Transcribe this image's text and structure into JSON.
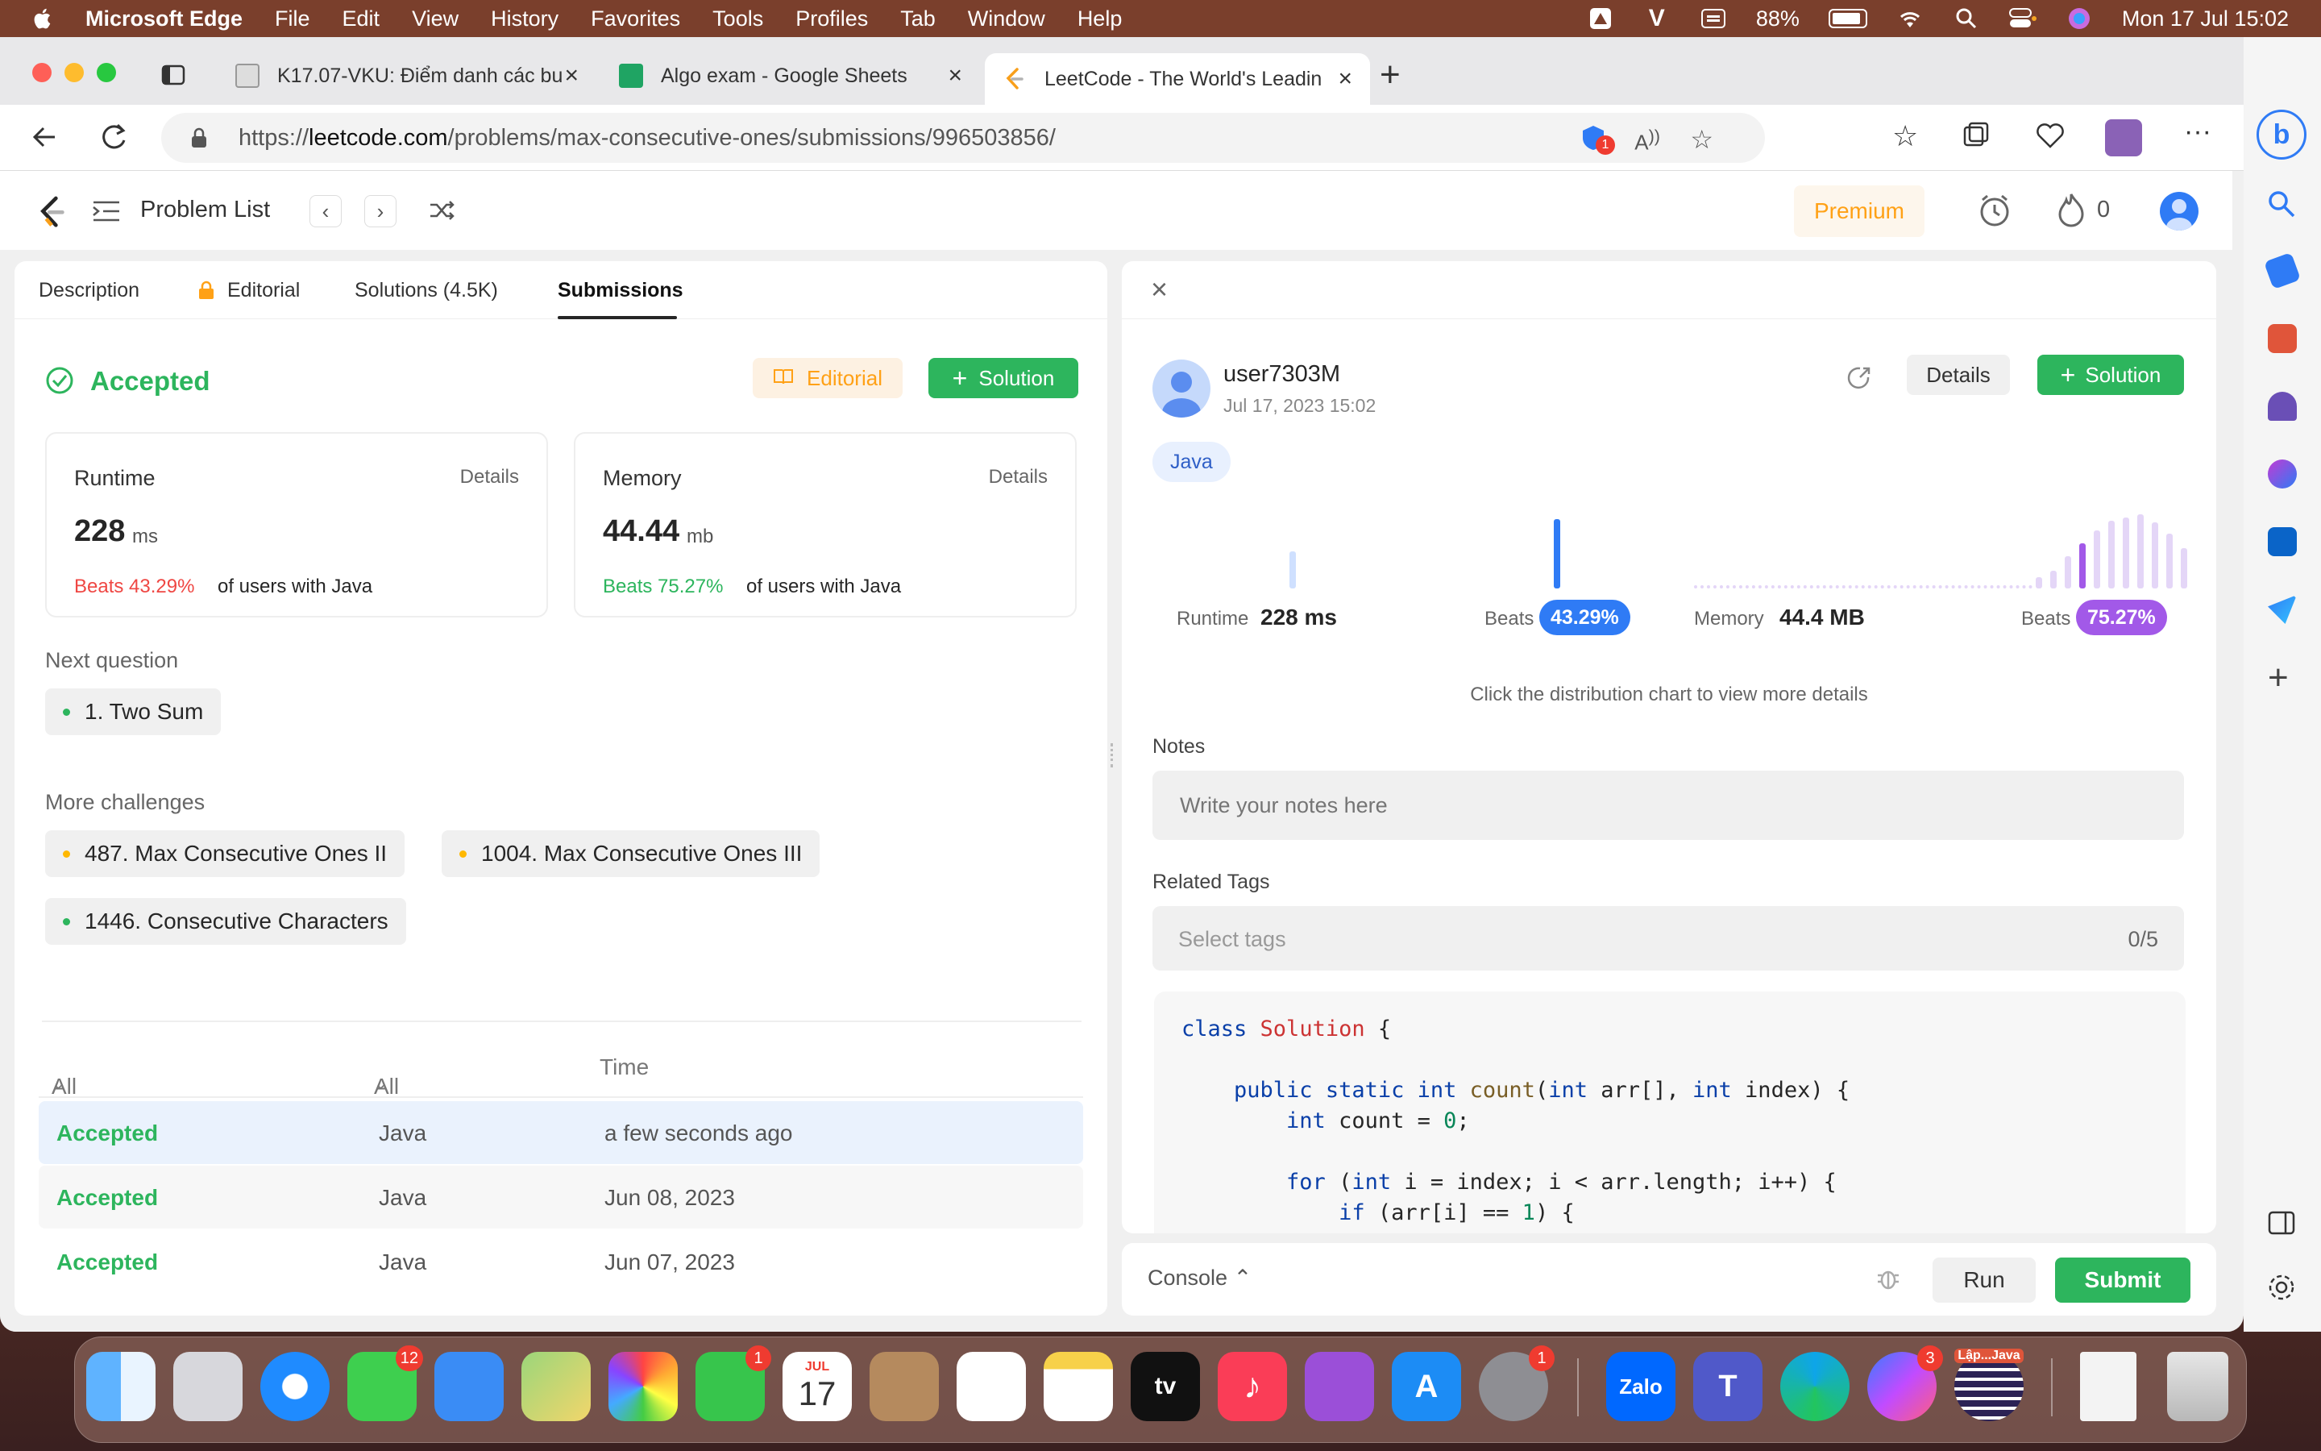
{
  "menubar": {
    "app_name": "Microsoft Edge",
    "items": [
      "File",
      "Edit",
      "View",
      "History",
      "Favorites",
      "Tools",
      "Profiles",
      "Tab",
      "Window",
      "Help"
    ],
    "battery": "88%",
    "datetime": "Mon 17 Jul  15:02"
  },
  "browser": {
    "tabs": [
      {
        "title": "K17.07-VKU: Điểm danh các bu"
      },
      {
        "title": "Algo exam - Google Sheets"
      },
      {
        "title": "LeetCode - The World's Leadin"
      }
    ],
    "url_prefix": "https://",
    "url_domain": "leetcode.com",
    "url_path": "/problems/max-consecutive-ones/submissions/996503856/",
    "extension_badge": "1"
  },
  "header": {
    "problem_list": "Problem List",
    "premium": "Premium",
    "streak": "0"
  },
  "left": {
    "tabs": [
      "Description",
      "Editorial",
      "Solutions (4.5K)",
      "Submissions"
    ],
    "status": "Accepted",
    "editorial_btn": "Editorial",
    "solution_btn": "Solution",
    "runtime": {
      "label": "Runtime",
      "details": "Details",
      "value": "228",
      "unit": "ms",
      "beats": "Beats 43.29%",
      "suffix": "of users with Java"
    },
    "memory": {
      "label": "Memory",
      "details": "Details",
      "value": "44.44",
      "unit": "mb",
      "beats": "Beats 75.27%",
      "suffix": "of users with Java"
    },
    "next_question_label": "Next question",
    "next_question": "1. Two Sum",
    "more_challenges_label": "More challenges",
    "challenges": [
      "487. Max Consecutive Ones II",
      "1004. Max Consecutive Ones III",
      "1446. Consecutive Characters"
    ],
    "table": {
      "headers": [
        "All statuses",
        "All languages",
        "Time"
      ],
      "rows": [
        {
          "status": "Accepted",
          "lang": "Java",
          "time": "a few seconds ago"
        },
        {
          "status": "Accepted",
          "lang": "Java",
          "time": "Jun 08, 2023"
        },
        {
          "status": "Accepted",
          "lang": "Java",
          "time": "Jun 07, 2023"
        }
      ]
    }
  },
  "right": {
    "username": "user7303M",
    "date": "Jul 17, 2023 15:02",
    "details_btn": "Details",
    "solution_btn": "Solution",
    "language": "Java",
    "runtime_label": "Runtime",
    "runtime_value": "228 ms",
    "beats_label": "Beats",
    "runtime_beats": "43.29%",
    "memory_label": "Memory",
    "memory_value": "44.4 MB",
    "memory_beats": "75.27%",
    "hint": "Click the distribution chart to view more details",
    "notes_label": "Notes",
    "notes_placeholder": "Write your notes here",
    "tags_label": "Related Tags",
    "tags_placeholder": "Select tags",
    "tags_count": "0/5",
    "console": "Console",
    "run": "Run",
    "submit": "Submit"
  },
  "code_lines": [
    "class Solution {",
    "",
    "    public static int count(int arr[], int index) {",
    "        int count = 0;",
    "",
    "        for (int i = index; i < arr.length; i++) {",
    "            if (arr[i] == 1) {"
  ],
  "dock": {
    "messages_badge": "12",
    "facetime_badge": "1",
    "calendar_month": "JUL",
    "calendar_day": "17",
    "settings_badge": "1",
    "zalo": "Zalo",
    "messenger_badge": "3",
    "java_label": "Lập...Java"
  },
  "colors": {
    "accent_green": "#2db55d",
    "accent_blue": "#2f7bf5",
    "accent_purple": "#a259e8",
    "premium_orange": "#ffa116"
  }
}
